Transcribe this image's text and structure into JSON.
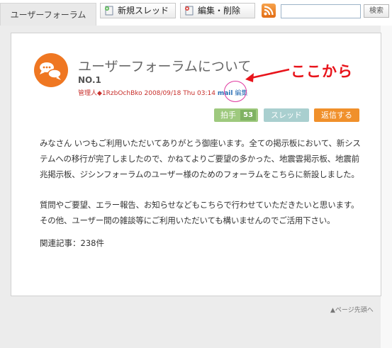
{
  "header": {
    "forum_tab": "ユーザーフォーラム",
    "new_thread_label": "新規スレッド",
    "edit_delete_label": "編集・削除",
    "search_placeholder": "",
    "search_button": "検索"
  },
  "post": {
    "title": "ユーザーフォーラムについて",
    "number": "NO.1",
    "poster": "管理人◆1RzbOchBko 2008/09/18 Thu 03:14",
    "mail_link": "mail",
    "edit_link": "編集",
    "clap_label": "拍手",
    "clap_count": "53",
    "thread_button": "スレッド",
    "reply_button": "返信する",
    "body_paragraph_1": "みなさん いつもご利用いただいてありがとう御座います。全ての掲示板において、新システムへの移行が完了しましたので、かねてよりご要望の多かった、地震雲掲示板、地震前兆掲示板、ジシンフォーラムのユーザー様のためのフォーラムをこちらに新設しました。",
    "body_paragraph_2": "質問やご要望、エラー報告、お知らせなどもこちらで行わせていただきたいと思います。その他、ユーザー間の雑談等にご利用いただいても構いませんのでご活用下さい。",
    "related_articles": "関連記事：238件"
  },
  "annotation": {
    "text": "ここから",
    "color": "#e8141b"
  },
  "footer": {
    "page_top": "▲ページ先頭へ"
  },
  "colors": {
    "accent_orange": "#f0902b",
    "clap_green": "#9ec97e",
    "thread_teal": "#a9cfcf",
    "poster_red": "#c8302c",
    "link_blue": "#2a6fb5"
  }
}
